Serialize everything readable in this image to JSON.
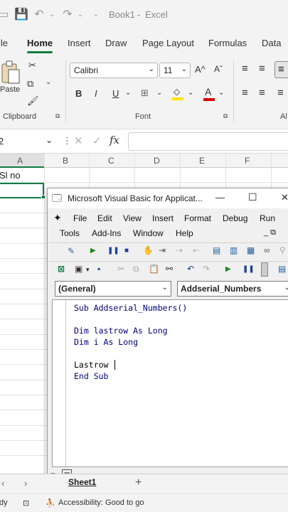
{
  "titlebar": {
    "book": "Book1",
    "app": "Excel",
    "separator": "-"
  },
  "tabs": [
    "ile",
    "Home",
    "Insert",
    "Draw",
    "Page Layout",
    "Formulas",
    "Data"
  ],
  "ribbon": {
    "paste_label": "Paste",
    "font_name": "Calibri",
    "font_size": "11",
    "grow_font": "A^",
    "shrink_font": "Aˇ",
    "bold": "B",
    "italic": "I",
    "underline": "U",
    "groups": {
      "clipboard": "Clipboard",
      "font": "Font",
      "alignment": "Al"
    }
  },
  "formula_bar": {
    "name_box": "2",
    "fx": "fx"
  },
  "grid": {
    "columns": [
      "A",
      "B",
      "C",
      "D",
      "E",
      "F"
    ],
    "cell_a1": "Sl no"
  },
  "sheet_tab": "Sheet1",
  "status": {
    "mode": "dy",
    "accessibility": "Accessibility: Good to go"
  },
  "vba": {
    "title": "Microsoft Visual Basic for Applicat...",
    "minimize": "—",
    "maximize": "☐",
    "close": "✕",
    "menu_row1": [
      "File",
      "Edit",
      "View",
      "Insert",
      "Format",
      "Debug",
      "Run"
    ],
    "menu_row2": [
      "Tools",
      "Add-Ins",
      "Window",
      "Help"
    ],
    "general_combo": "(General)",
    "proc_combo": "Addserial_Numbers",
    "code": [
      "Sub Addserial_Numbers()",
      "",
      "Dim lastrow As Long",
      "Dim i As Long",
      "",
      "Lastrow",
      "End Sub"
    ]
  }
}
